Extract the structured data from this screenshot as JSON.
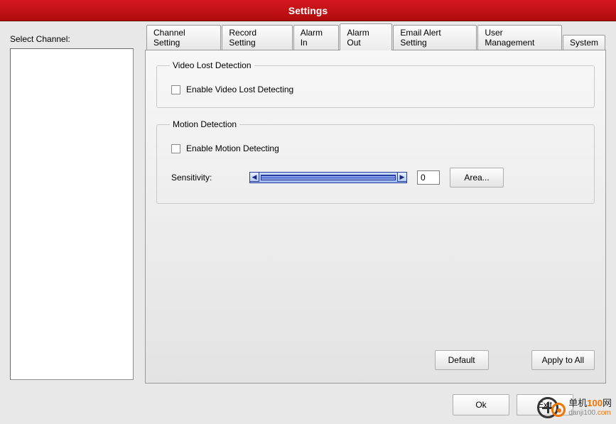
{
  "title": "Settings",
  "left": {
    "label": "Select Channel:"
  },
  "tabs": {
    "channel_setting": "Channel Setting",
    "record_setting": "Record Setting",
    "alarm_in": "Alarm In",
    "alarm_out": "Alarm Out",
    "email_alert": "Email Alert Setting",
    "user_mgmt": "User Management",
    "system": "System",
    "active": "alarm_out"
  },
  "video_lost": {
    "legend": "Video Lost Detection",
    "enable_label": "Enable Video Lost Detecting",
    "enabled": false
  },
  "motion": {
    "legend": "Motion Detection",
    "enable_label": "Enable Motion Detecting",
    "enabled": false,
    "sensitivity_label": "Sensitivity:",
    "sensitivity_value": "0",
    "area_button": "Area..."
  },
  "buttons": {
    "default": "Default",
    "apply_all": "Apply to All",
    "ok": "Ok",
    "exit": "Exit"
  },
  "watermark": {
    "line1_a": "单机",
    "line1_b": "100",
    "line1_c": "网",
    "line2_a": "danji100",
    "line2_b": ".com"
  }
}
